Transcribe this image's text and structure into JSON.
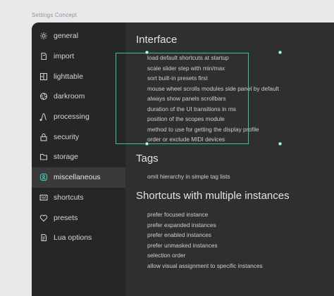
{
  "caption": "Settings Concept",
  "sidebar": {
    "items": [
      {
        "label": "general",
        "icon": "gear-icon"
      },
      {
        "label": "import",
        "icon": "import-icon"
      },
      {
        "label": "lighttable",
        "icon": "lighttable-icon"
      },
      {
        "label": "darkroom",
        "icon": "darkroom-icon"
      },
      {
        "label": "processing",
        "icon": "processing-icon"
      },
      {
        "label": "security",
        "icon": "lock-icon"
      },
      {
        "label": "storage",
        "icon": "folder-icon"
      },
      {
        "label": "miscellaneous",
        "icon": "miscellaneous-icon",
        "active": true
      },
      {
        "label": "shortcuts",
        "icon": "keyboard-icon"
      },
      {
        "label": "presets",
        "icon": "heart-icon"
      },
      {
        "label": "Lua options",
        "icon": "lua-icon"
      }
    ]
  },
  "main": {
    "sections": [
      {
        "title": "Interface",
        "options": [
          "load default shortcuts at startup",
          "scale slider step with min/max",
          "sort built-in presets first",
          "mouse wheel scrolls modules side panel by default",
          "always show panels scrollbars",
          "duration of the UI transitions in ms",
          "position of the scopes module",
          "method to use for getting the display profile",
          "order or exclude MIDI devices"
        ]
      },
      {
        "title": "Tags",
        "options": [
          "omit hierarchy in simple tag lists"
        ]
      },
      {
        "title": "Shortcuts with multiple instances",
        "options": [
          "prefer focused instance",
          "prefer expanded instances",
          "prefer enabled instances",
          "prefer unmasked instances",
          "selection order",
          "allow visual assignment to specific instances"
        ]
      }
    ]
  },
  "colors": {
    "accent": "#3fbfae",
    "sidebar_bg": "#262626",
    "content_bg": "#2f2f2f",
    "active_item_bg": "#3a3a3a",
    "active_icon": "#3fbfae"
  }
}
